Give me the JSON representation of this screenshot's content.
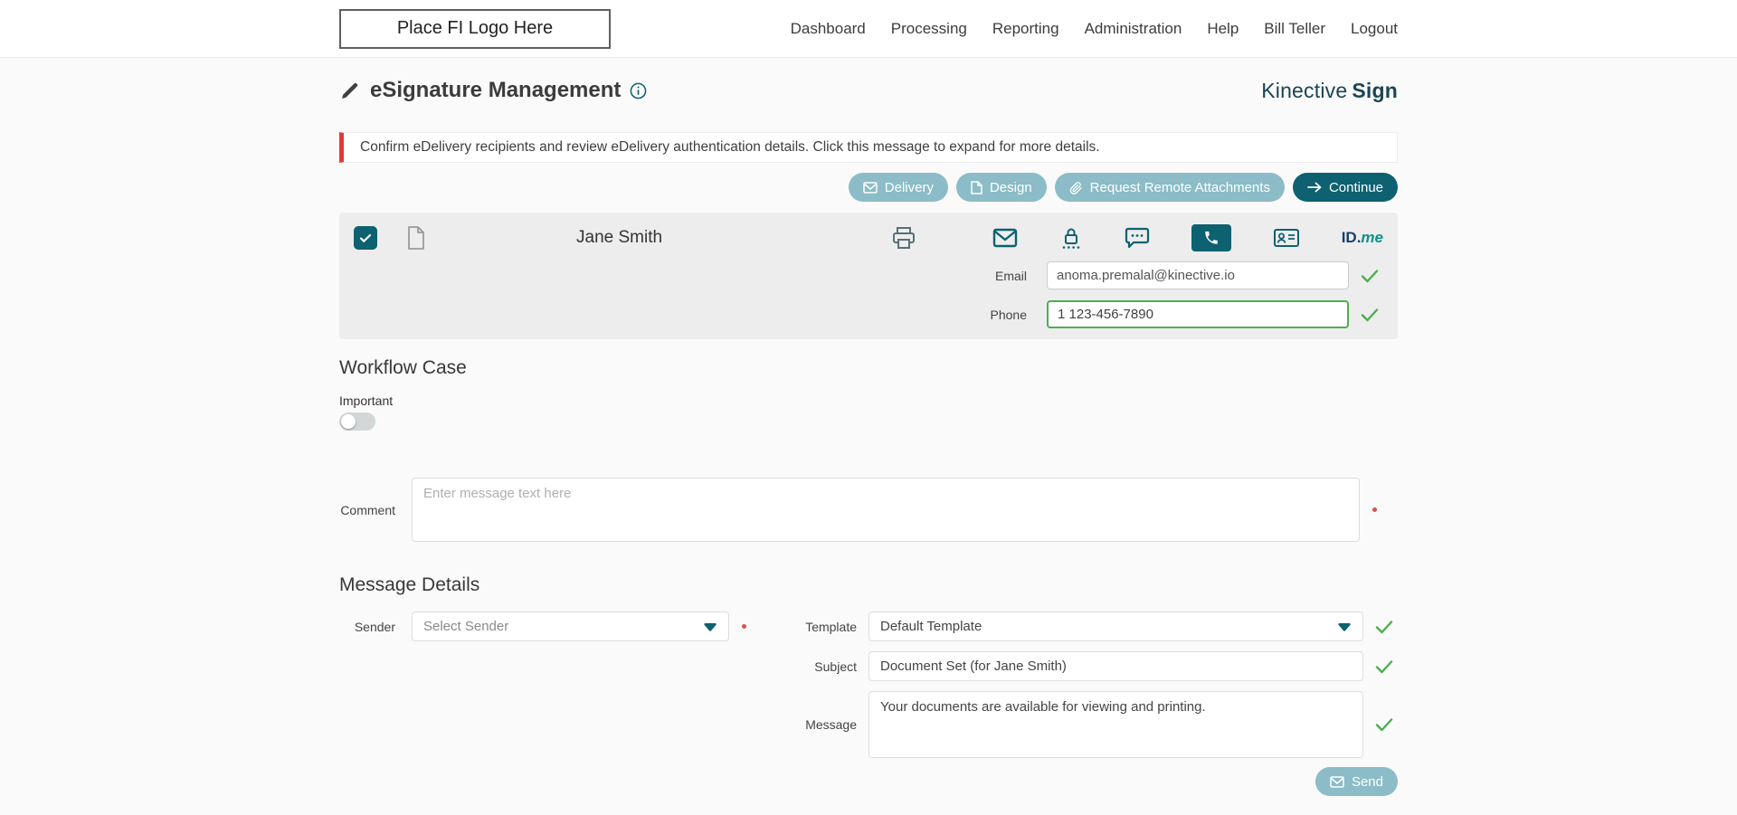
{
  "colors": {
    "teal_dark": "#0d6170",
    "teal_muted": "#8bbcc7",
    "brand_navy": "#1b4552",
    "success_green": "#4caf50",
    "alert_red": "#e53935"
  },
  "header": {
    "logo_text": "Place FI Logo Here",
    "nav": [
      "Dashboard",
      "Processing",
      "Reporting",
      "Administration",
      "Help",
      "Bill Teller",
      "Logout"
    ]
  },
  "page": {
    "title": "eSignature Management",
    "brand_first": "Kinective",
    "brand_second": "Sign",
    "alert_message": "Confirm eDelivery recipients and review eDelivery authentication details. Click this message to expand for more details."
  },
  "toolbar": {
    "delivery_label": "Delivery",
    "design_label": "Design",
    "request_remote_label": "Request Remote Attachments",
    "continue_label": "Continue"
  },
  "recipient": {
    "name": "Jane Smith",
    "email_label": "Email",
    "email_value": "anoma.premalal@kinective.io",
    "phone_label": "Phone",
    "phone_value": "1 123-456-7890",
    "idme_id": "ID.",
    "idme_me": "me"
  },
  "workflow": {
    "section_title": "Workflow Case",
    "important_label": "Important",
    "comment_label": "Comment",
    "comment_placeholder": "Enter message text here"
  },
  "message_details": {
    "section_title": "Message Details",
    "sender_label": "Sender",
    "sender_value": "Select Sender",
    "template_label": "Template",
    "template_value": "Default Template",
    "subject_label": "Subject",
    "subject_value": "Document Set (for Jane Smith)",
    "message_label": "Message",
    "message_value": "Your documents are available for viewing and printing.",
    "send_label": "Send"
  }
}
